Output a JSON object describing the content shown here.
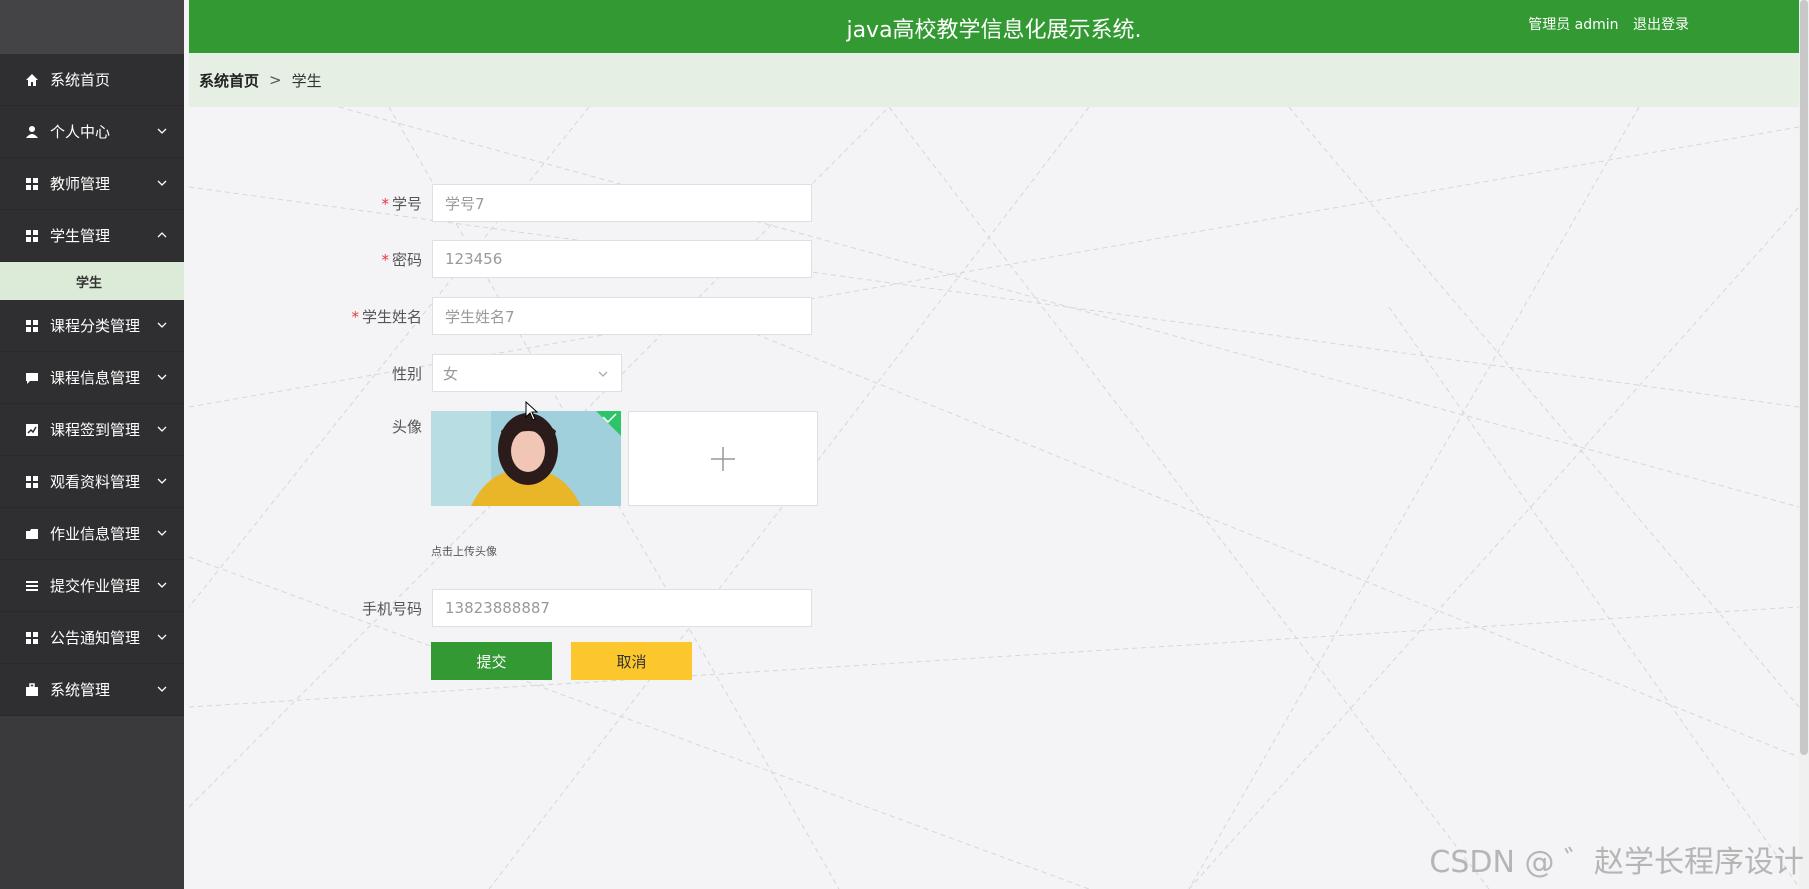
{
  "header": {
    "title": "java高校教学信息化展示系统.",
    "user_label": "管理员 admin",
    "logout_label": "退出登录"
  },
  "breadcrumb": {
    "home": "系统首页",
    "separator": ">",
    "current": "学生"
  },
  "sidebar": {
    "items": [
      {
        "label": "系统首页",
        "icon": "home-icon"
      },
      {
        "label": "个人中心",
        "icon": "user-icon"
      },
      {
        "label": "教师管理",
        "icon": "grid-icon"
      },
      {
        "label": "学生管理",
        "icon": "grid-icon",
        "expanded": true
      },
      {
        "label": "课程分类管理",
        "icon": "grid-icon"
      },
      {
        "label": "课程信息管理",
        "icon": "chat-icon"
      },
      {
        "label": "课程签到管理",
        "icon": "chart-icon"
      },
      {
        "label": "观看资料管理",
        "icon": "grid-icon"
      },
      {
        "label": "作业信息管理",
        "icon": "folder-icon"
      },
      {
        "label": "提交作业管理",
        "icon": "list-icon"
      },
      {
        "label": "公告通知管理",
        "icon": "grid-icon"
      },
      {
        "label": "系统管理",
        "icon": "briefcase-icon"
      }
    ],
    "sub_items": {
      "student": "学生"
    }
  },
  "form": {
    "student_no": {
      "label": "学号",
      "value": "学号7"
    },
    "password": {
      "label": "密码",
      "value": "123456"
    },
    "student_name": {
      "label": "学生姓名",
      "value": "学生姓名7"
    },
    "gender": {
      "label": "性别",
      "value": "女"
    },
    "avatar": {
      "label": "头像",
      "tip": "点击上传头像"
    },
    "phone": {
      "label": "手机号码",
      "value": "13823888887"
    },
    "submit_label": "提交",
    "cancel_label": "取消"
  },
  "watermark": "CSDN @ ゛赵学长程序设计",
  "colors": {
    "primary": "#339933",
    "cancel": "#fcc72c",
    "sidebar": "#2f2f31",
    "breadcrumb_bg": "#e5efe4"
  }
}
